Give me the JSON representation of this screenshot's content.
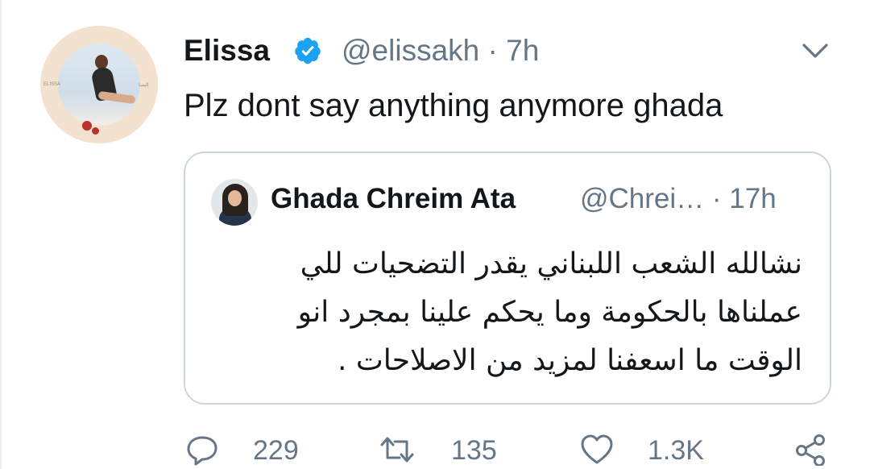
{
  "tweet": {
    "author_name": "Elissa",
    "handle_time": "@elissakh · 7h",
    "text": "Plz dont say anything anymore ghada",
    "avatar_tag_left": "ELISSA",
    "avatar_tag_right": "إليسا"
  },
  "quote": {
    "author_name": "Ghada Chreim Ata",
    "handle_time": "@Chrei… · 17h",
    "lines": [
      "نشالله الشعب اللبناني يقدر التضحيات للي",
      "عملناها بالحكومة وما يحكم علينا بمجرد انو",
      "الوقت ما اسعفنا لمزيد من الاصلاحات ."
    ]
  },
  "actions": {
    "reply_count": "229",
    "retweet_count": "135",
    "like_count": "1.3K"
  },
  "colors": {
    "verified": "#1da1f2",
    "secondary_text": "#657786",
    "border": "#ccd6dd"
  },
  "icons": [
    "verified-badge-icon",
    "chevron-down-icon",
    "reply-icon",
    "retweet-icon",
    "like-icon",
    "share-icon"
  ]
}
